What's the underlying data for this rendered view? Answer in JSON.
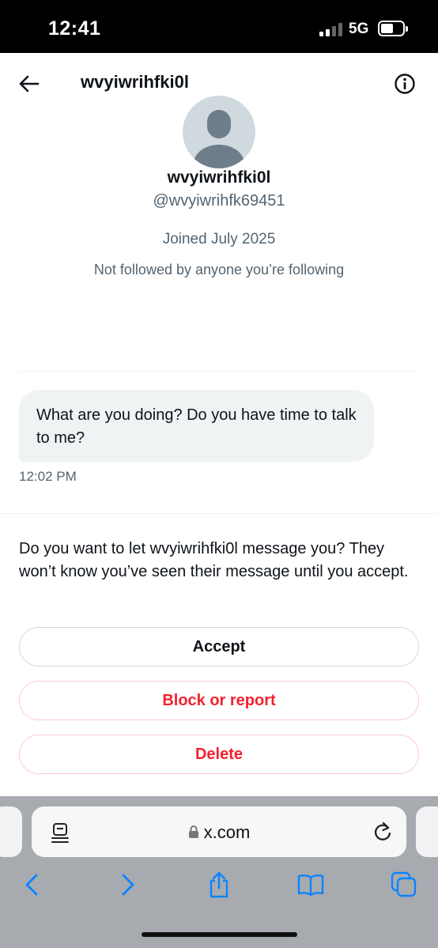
{
  "status_bar": {
    "time": "12:41",
    "network": "5G"
  },
  "header": {
    "title": "wvyiwrihfki0l"
  },
  "profile": {
    "name": "wvyiwrihfki0l",
    "handle": "@wvyiwrihfk69451",
    "joined": "Joined July 2025",
    "followed_by": "Not followed by anyone you’re following"
  },
  "conversation": {
    "message": "What are you doing? Do you have time to talk to me?",
    "time": "12:02 PM"
  },
  "request": {
    "prompt": "Do you want to let wvyiwrihfki0l message you? They won’t know you’ve seen their message until you accept.",
    "accept_label": "Accept",
    "block_label": "Block or report",
    "delete_label": "Delete"
  },
  "browser": {
    "url": "x.com"
  },
  "colors": {
    "accent_red": "#f4212e",
    "text_secondary": "#536471",
    "ios_blue": "#0a84ff"
  }
}
